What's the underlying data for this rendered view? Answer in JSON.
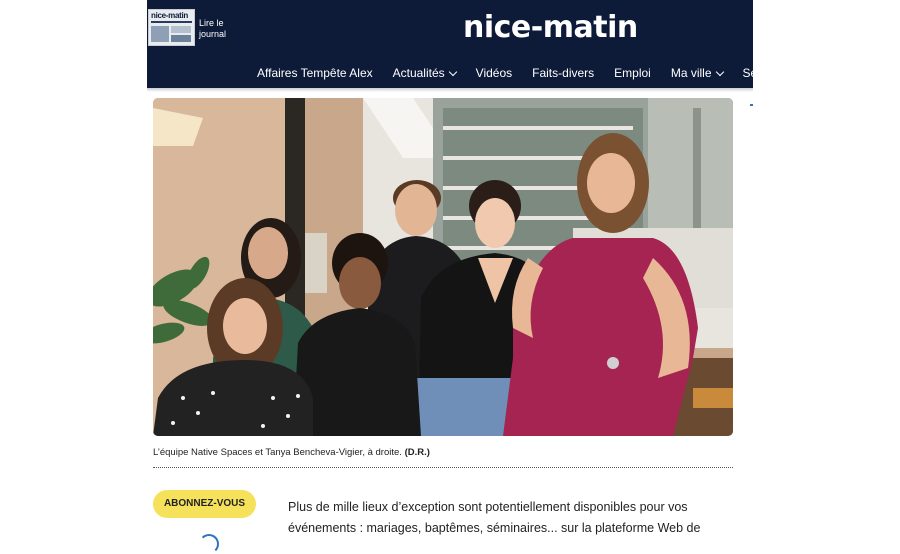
{
  "header": {
    "read_journal": "Lire le journal",
    "thumb_masthead": "nice-matin",
    "logo": "nice-matin",
    "nav": [
      "Affaires Tempête Alex",
      "Actualités",
      "Vidéos",
      "Faits-divers",
      "Emploi",
      "Ma ville",
      "Ser"
    ],
    "nav_dropdown": [
      false,
      true,
      false,
      false,
      false,
      true,
      false
    ]
  },
  "photo": {
    "alt": "L’équipe Native Spaces et Tanya Bencheva-Vigier, à droite."
  },
  "caption": {
    "text": "L’équipe Native Spaces et Tanya Bencheva-Vigier, à droite.",
    "credit": "(D.R.)"
  },
  "subscribe": {
    "label": "ABONNEZ-VOUS"
  },
  "article": {
    "line1": "Plus de mille lieux d’exception sont potentiellement disponibles pour vos",
    "line2": "événements : mariages, baptêmes, séminaires... sur la plateforme Web de"
  },
  "colors": {
    "header_bg": "#0d1a38",
    "subscribe_bg": "#f6e25a",
    "accent": "#2f74c0"
  }
}
